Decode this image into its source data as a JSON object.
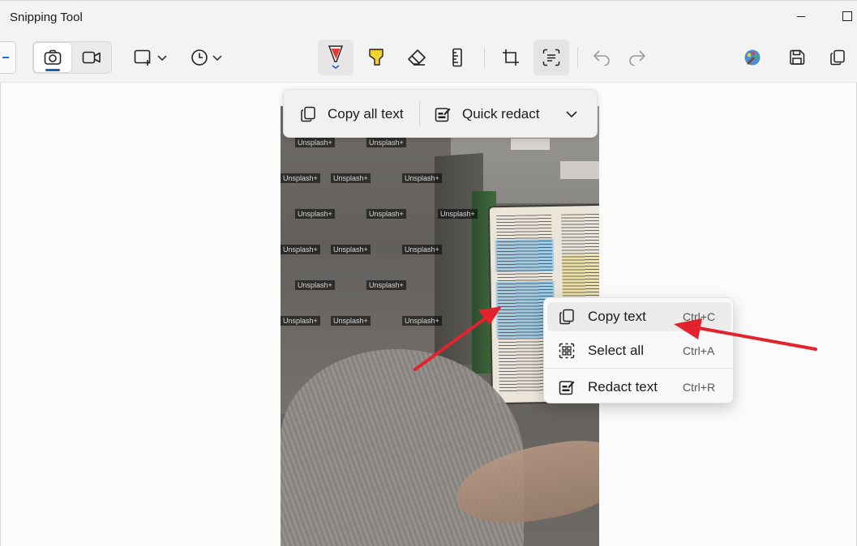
{
  "window": {
    "title": "Snipping Tool",
    "minimize_icon": "minimize-icon",
    "maximize_icon": "maximize-icon"
  },
  "toolbar": {
    "icons": [
      "new-snip-icon",
      "camera-icon",
      "video-icon",
      "snip-shape-icon",
      "chevron-down-icon",
      "clock-icon",
      "pen-icon",
      "highlighter-icon",
      "eraser-icon",
      "ruler-icon",
      "crop-icon",
      "text-actions-icon",
      "undo-icon",
      "redo-icon",
      "paint-icon",
      "save-icon",
      "copy-icon"
    ],
    "selected_mode": "screenshot",
    "pen_color": "#e23b3b",
    "highlighter_color": "#f2d233"
  },
  "text_actions_bar": {
    "copy_all_label": "Copy all text",
    "quick_redact_label": "Quick redact"
  },
  "context_menu": {
    "items": [
      {
        "label": "Copy text",
        "shortcut": "Ctrl+C",
        "icon": "copy-icon"
      },
      {
        "label": "Select all",
        "shortcut": "Ctrl+A",
        "icon": "select-all-icon"
      },
      {
        "label": "Redact text",
        "shortcut": "Ctrl+R",
        "icon": "redact-icon"
      }
    ]
  },
  "image": {
    "watermark": "Unsplash+"
  },
  "annotation": {
    "arrow_color": "#e2232e"
  }
}
